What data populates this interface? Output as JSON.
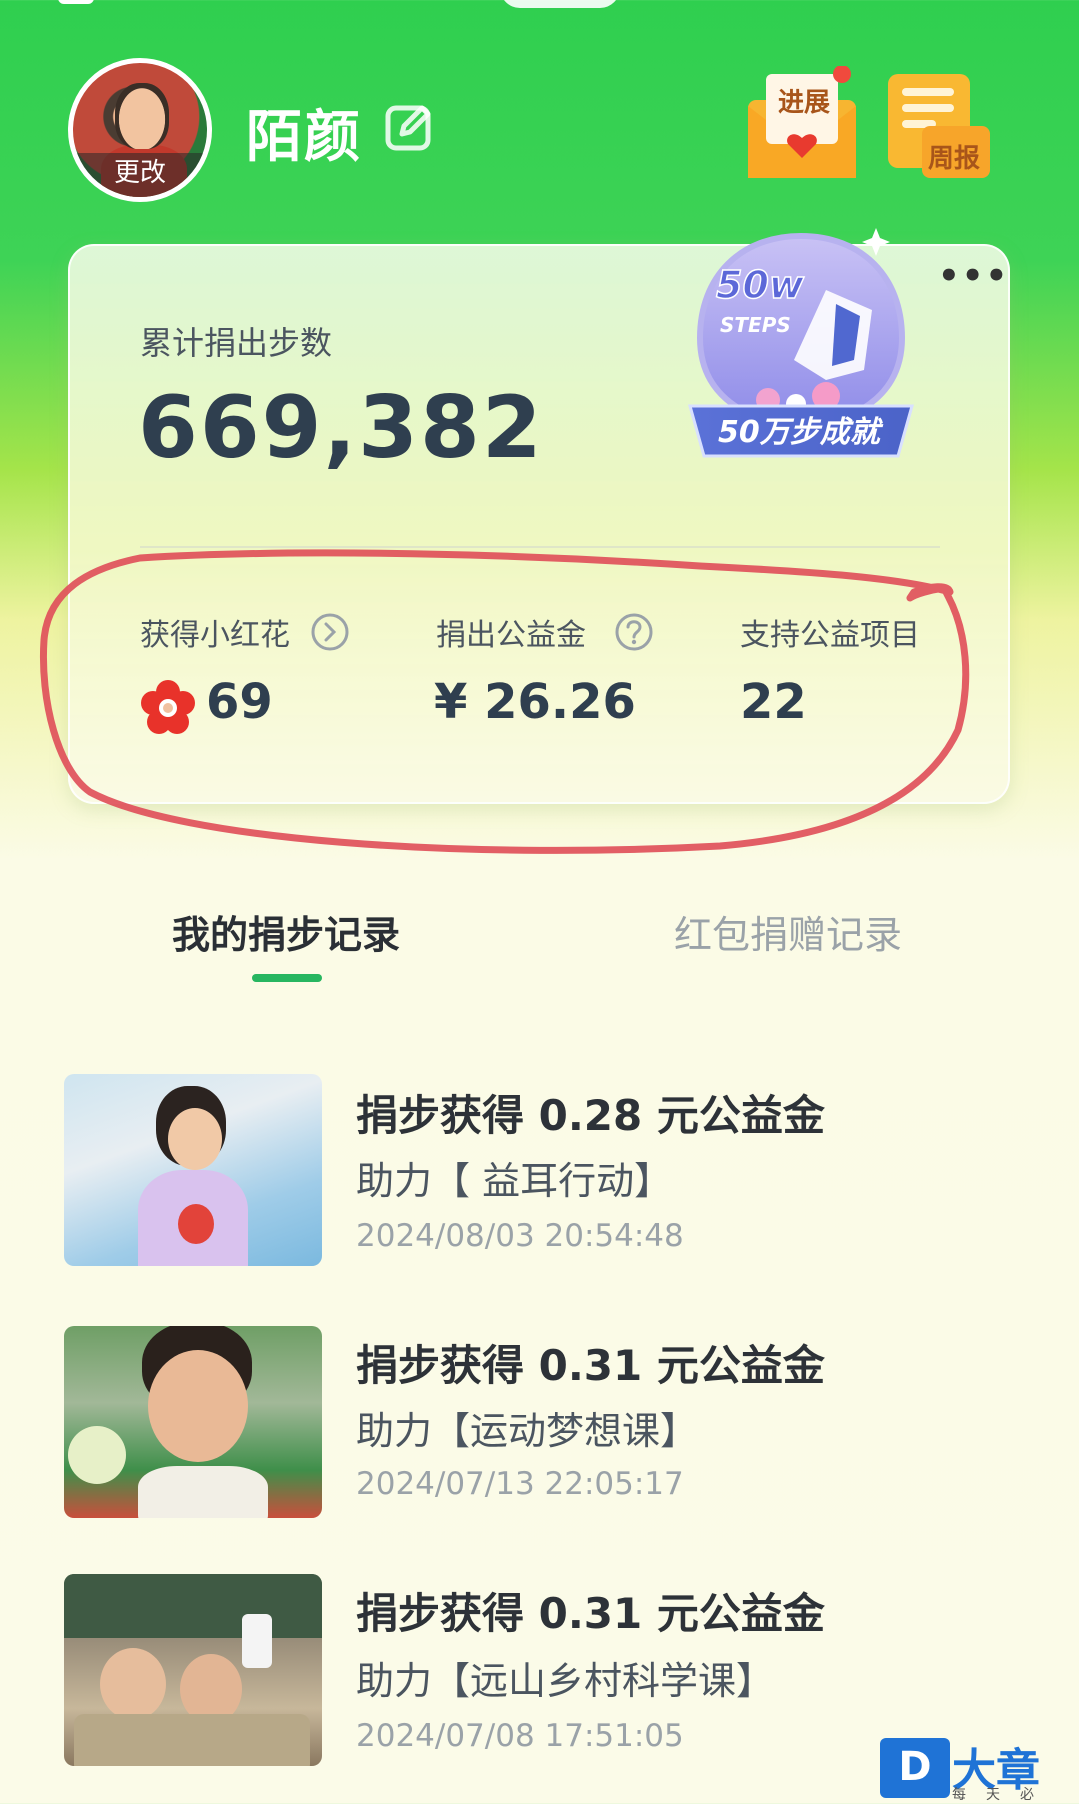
{
  "profile": {
    "avatar_action": "更改",
    "username": "陌颜"
  },
  "header_badges": {
    "progress_label": "进展",
    "weekly_label": "周报"
  },
  "stats_card": {
    "total_label": "累计捐出步数",
    "total_value": "669,382",
    "achievement_badge": {
      "top": "50w",
      "sub": "STEPS",
      "ribbon": "50万步成就"
    },
    "flowers": {
      "label": "获得小红花",
      "value": "69"
    },
    "donated": {
      "label": "捐出公益金",
      "value": "¥ 26.26"
    },
    "projects": {
      "label": "支持公益项目",
      "value": "22"
    }
  },
  "tabs": [
    {
      "label": "我的捐步记录",
      "active": true
    },
    {
      "label": "红包捐赠记录",
      "active": false
    }
  ],
  "records": [
    {
      "title": "捐步获得 0.28 元公益金",
      "subtitle": "助力【 益耳行动】",
      "time": "2024/08/03 20:54:48"
    },
    {
      "title": "捐步获得 0.31 元公益金",
      "subtitle": "助力【运动梦想课】",
      "time": "2024/07/13 22:05:17"
    },
    {
      "title": "捐步获得 0.31 元公益金",
      "subtitle": "助力【远山乡村科学课】",
      "time": "2024/07/08 17:51:05"
    }
  ],
  "watermark": {
    "mark": "D",
    "name": "大章丘",
    "slogan": "每天必看"
  },
  "colors": {
    "header_green": "#2fcf4f",
    "tab_underline": "#27b660",
    "annotation_red": "#e0505a",
    "watermark_blue": "#1f73d6"
  }
}
